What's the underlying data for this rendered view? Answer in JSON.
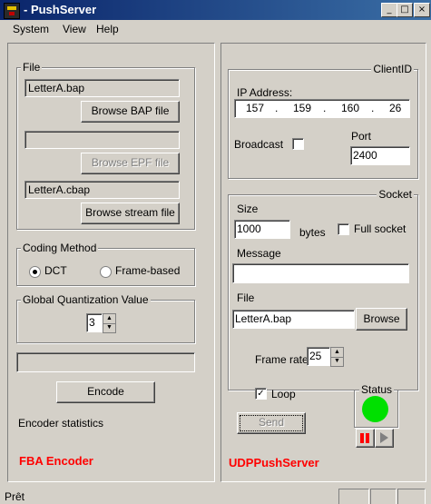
{
  "window": {
    "title": "- PushServer",
    "controls": {
      "minimize": "_",
      "maximize": "□",
      "close": "×"
    }
  },
  "menu": {
    "items": [
      "System",
      "View",
      "Help"
    ]
  },
  "encoder": {
    "file_group": "File",
    "bap_file": "LetterA.bap",
    "browse_bap": "Browse BAP file",
    "epf_file": "",
    "browse_epf": "Browse EPF file",
    "stream_file": "LetterA.cbap",
    "browse_stream": "Browse stream file",
    "coding_group": "Coding Method",
    "coding_options": [
      "DCT",
      "Frame-based"
    ],
    "coding_selected": "DCT",
    "quant_group": "Global Quantization Value",
    "quant_value": "3",
    "progress": 0,
    "encode_button": "Encode",
    "stats_label": "Encoder statistics",
    "brand": "FBA Encoder"
  },
  "server": {
    "client_group": "ClientID",
    "ip_label": "IP Address:",
    "ip": [
      "157",
      "159",
      "160",
      "26"
    ],
    "broadcast_label": "Broadcast",
    "broadcast_checked": false,
    "port_label": "Port",
    "port_value": "2400",
    "socket_group": "Socket",
    "size_label": "Size",
    "size_value": "1000",
    "bytes_label": "bytes",
    "full_socket_label": "Full socket",
    "full_socket_checked": false,
    "message_label": "Message",
    "message_value": "",
    "file_label": "File",
    "file_value": "LetterA.bap",
    "browse_label": "Browse",
    "frame_rate_label": "Frame rate",
    "frame_rate_value": "25",
    "loop_label": "Loop",
    "loop_checked": true,
    "send_button": "Send",
    "status_group": "Status",
    "status_color": "#00e000",
    "brand": "UDPPushServer"
  },
  "statusbar": {
    "text": "Prêt"
  }
}
